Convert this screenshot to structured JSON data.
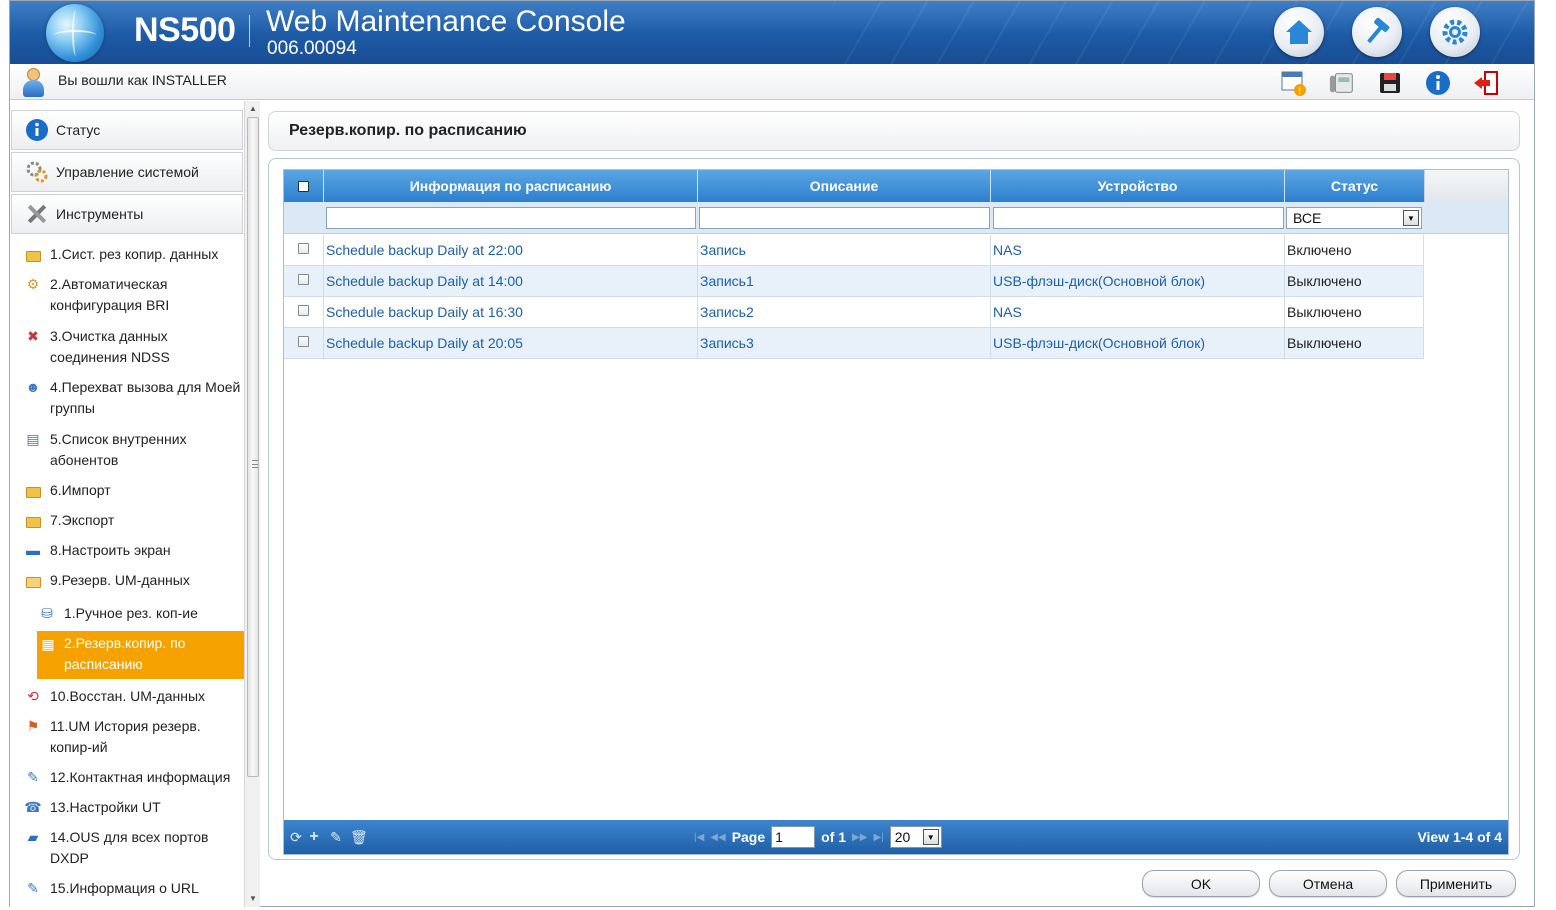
{
  "header": {
    "brand": "NS500",
    "title": "Web Maintenance Console",
    "version": "006.00094"
  },
  "subheader": {
    "login_text": "Вы вошли как INSTALLER"
  },
  "sidebar": {
    "accordions": [
      {
        "label": "Статус",
        "icon": "info-icon"
      },
      {
        "label": "Управление системой",
        "icon": "gears-icon"
      },
      {
        "label": "Инструменты",
        "icon": "tools-icon"
      }
    ],
    "items": [
      {
        "label": "1.Сист. рез копир. данных",
        "icon": "folder-icon"
      },
      {
        "label": "2.Автоматическая конфигурация BRI",
        "icon": "config-icon"
      },
      {
        "label": "3.Очистка данных соединения NDSS",
        "icon": "clear-icon"
      },
      {
        "label": "4.Перехват вызова для Моей группы",
        "icon": "group-icon"
      },
      {
        "label": "5.Список внутренних абонентов",
        "icon": "list-icon"
      },
      {
        "label": "6.Импорт",
        "icon": "folder-icon"
      },
      {
        "label": "7.Экспорт",
        "icon": "folder-icon"
      },
      {
        "label": "8.Настроить экран",
        "icon": "monitor-icon"
      },
      {
        "label": "9.Резерв. UM-данных",
        "icon": "folder-open-icon"
      },
      {
        "label": "1.Ручное рез. коп-ие",
        "icon": "backup-icon"
      },
      {
        "label": "2.Резерв.копир. по расписанию",
        "icon": "schedule-icon"
      },
      {
        "label": "10.Восстан. UM-данных",
        "icon": "restore-icon"
      },
      {
        "label": "11.UM История резерв. копир-ий",
        "icon": "history-icon"
      },
      {
        "label": "12.Контактная информация",
        "icon": "contact-icon"
      },
      {
        "label": "13.Настройки UT",
        "icon": "settings-icon"
      },
      {
        "label": "14.OUS для всех портов DXDP",
        "icon": "port-icon"
      },
      {
        "label": "15.Информация о URL",
        "icon": "url-icon"
      }
    ]
  },
  "main": {
    "page_title": "Резерв.копир. по расписанию",
    "columns": [
      "Информация по расписанию",
      "Описание",
      "Устройство",
      "Статус"
    ],
    "filter_status": "ВСЕ",
    "rows": [
      {
        "info": "Schedule backup Daily at 22:00",
        "desc": "Запись",
        "device": "NAS",
        "status": "Включено"
      },
      {
        "info": "Schedule backup Daily at 14:00",
        "desc": "Запись1",
        "device": "USB-флэш-диск(Основной блок)",
        "status": "Выключено"
      },
      {
        "info": "Schedule backup Daily at 16:30",
        "desc": "Запись2",
        "device": "NAS",
        "status": "Выключено"
      },
      {
        "info": "Schedule backup Daily at 20:05",
        "desc": "Запись3",
        "device": "USB-флэш-диск(Основной блок)",
        "status": "Выключено"
      }
    ],
    "pager": {
      "page_label": "Page",
      "page_value": "1",
      "of_label": "of 1",
      "page_size": "20",
      "view_info": "View 1-4 of 4"
    }
  },
  "buttons": {
    "ok": "OK",
    "cancel": "Отмена",
    "apply": "Применить"
  },
  "colors": {
    "header_blue": "#1d5aa6",
    "active_orange": "#f5a200",
    "link_blue": "#1b5fa8"
  }
}
